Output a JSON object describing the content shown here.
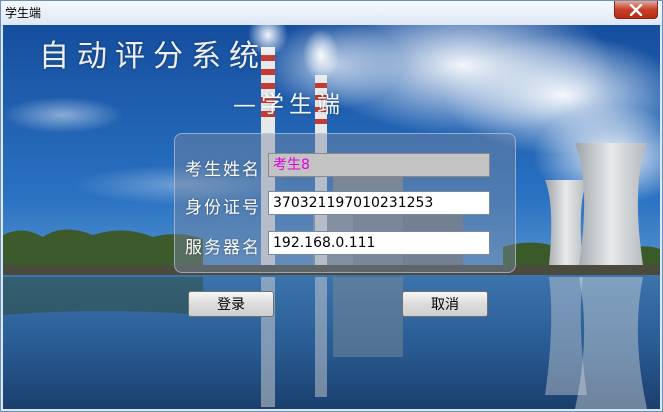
{
  "window": {
    "title": "学生端",
    "close_icon": "close-icon"
  },
  "header": {
    "app_title": "自动评分系统",
    "subtitle": "—学生端"
  },
  "form": {
    "name_label": "考生姓名",
    "name_value": "考生8",
    "id_label": "身份证号",
    "id_value": "370321197010231253",
    "server_label": "服务器名",
    "server_value": "192.168.0.111"
  },
  "buttons": {
    "login_label": "登录",
    "cancel_label": "取消"
  },
  "colors": {
    "accent_text": "#e000e0",
    "close_button": "#c5402a",
    "sky": "#1d5fb0"
  }
}
